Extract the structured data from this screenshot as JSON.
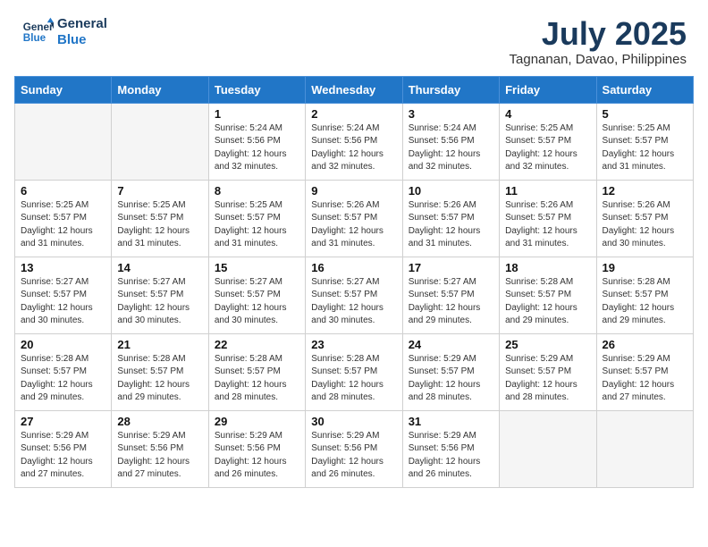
{
  "header": {
    "logo_line1": "General",
    "logo_line2": "Blue",
    "month_year": "July 2025",
    "location": "Tagnanan, Davao, Philippines"
  },
  "weekdays": [
    "Sunday",
    "Monday",
    "Tuesday",
    "Wednesday",
    "Thursday",
    "Friday",
    "Saturday"
  ],
  "weeks": [
    [
      {
        "day": "",
        "detail": ""
      },
      {
        "day": "",
        "detail": ""
      },
      {
        "day": "1",
        "detail": "Sunrise: 5:24 AM\nSunset: 5:56 PM\nDaylight: 12 hours\nand 32 minutes."
      },
      {
        "day": "2",
        "detail": "Sunrise: 5:24 AM\nSunset: 5:56 PM\nDaylight: 12 hours\nand 32 minutes."
      },
      {
        "day": "3",
        "detail": "Sunrise: 5:24 AM\nSunset: 5:56 PM\nDaylight: 12 hours\nand 32 minutes."
      },
      {
        "day": "4",
        "detail": "Sunrise: 5:25 AM\nSunset: 5:57 PM\nDaylight: 12 hours\nand 32 minutes."
      },
      {
        "day": "5",
        "detail": "Sunrise: 5:25 AM\nSunset: 5:57 PM\nDaylight: 12 hours\nand 31 minutes."
      }
    ],
    [
      {
        "day": "6",
        "detail": "Sunrise: 5:25 AM\nSunset: 5:57 PM\nDaylight: 12 hours\nand 31 minutes."
      },
      {
        "day": "7",
        "detail": "Sunrise: 5:25 AM\nSunset: 5:57 PM\nDaylight: 12 hours\nand 31 minutes."
      },
      {
        "day": "8",
        "detail": "Sunrise: 5:25 AM\nSunset: 5:57 PM\nDaylight: 12 hours\nand 31 minutes."
      },
      {
        "day": "9",
        "detail": "Sunrise: 5:26 AM\nSunset: 5:57 PM\nDaylight: 12 hours\nand 31 minutes."
      },
      {
        "day": "10",
        "detail": "Sunrise: 5:26 AM\nSunset: 5:57 PM\nDaylight: 12 hours\nand 31 minutes."
      },
      {
        "day": "11",
        "detail": "Sunrise: 5:26 AM\nSunset: 5:57 PM\nDaylight: 12 hours\nand 31 minutes."
      },
      {
        "day": "12",
        "detail": "Sunrise: 5:26 AM\nSunset: 5:57 PM\nDaylight: 12 hours\nand 30 minutes."
      }
    ],
    [
      {
        "day": "13",
        "detail": "Sunrise: 5:27 AM\nSunset: 5:57 PM\nDaylight: 12 hours\nand 30 minutes."
      },
      {
        "day": "14",
        "detail": "Sunrise: 5:27 AM\nSunset: 5:57 PM\nDaylight: 12 hours\nand 30 minutes."
      },
      {
        "day": "15",
        "detail": "Sunrise: 5:27 AM\nSunset: 5:57 PM\nDaylight: 12 hours\nand 30 minutes."
      },
      {
        "day": "16",
        "detail": "Sunrise: 5:27 AM\nSunset: 5:57 PM\nDaylight: 12 hours\nand 30 minutes."
      },
      {
        "day": "17",
        "detail": "Sunrise: 5:27 AM\nSunset: 5:57 PM\nDaylight: 12 hours\nand 29 minutes."
      },
      {
        "day": "18",
        "detail": "Sunrise: 5:28 AM\nSunset: 5:57 PM\nDaylight: 12 hours\nand 29 minutes."
      },
      {
        "day": "19",
        "detail": "Sunrise: 5:28 AM\nSunset: 5:57 PM\nDaylight: 12 hours\nand 29 minutes."
      }
    ],
    [
      {
        "day": "20",
        "detail": "Sunrise: 5:28 AM\nSunset: 5:57 PM\nDaylight: 12 hours\nand 29 minutes."
      },
      {
        "day": "21",
        "detail": "Sunrise: 5:28 AM\nSunset: 5:57 PM\nDaylight: 12 hours\nand 29 minutes."
      },
      {
        "day": "22",
        "detail": "Sunrise: 5:28 AM\nSunset: 5:57 PM\nDaylight: 12 hours\nand 28 minutes."
      },
      {
        "day": "23",
        "detail": "Sunrise: 5:28 AM\nSunset: 5:57 PM\nDaylight: 12 hours\nand 28 minutes."
      },
      {
        "day": "24",
        "detail": "Sunrise: 5:29 AM\nSunset: 5:57 PM\nDaylight: 12 hours\nand 28 minutes."
      },
      {
        "day": "25",
        "detail": "Sunrise: 5:29 AM\nSunset: 5:57 PM\nDaylight: 12 hours\nand 28 minutes."
      },
      {
        "day": "26",
        "detail": "Sunrise: 5:29 AM\nSunset: 5:57 PM\nDaylight: 12 hours\nand 27 minutes."
      }
    ],
    [
      {
        "day": "27",
        "detail": "Sunrise: 5:29 AM\nSunset: 5:56 PM\nDaylight: 12 hours\nand 27 minutes."
      },
      {
        "day": "28",
        "detail": "Sunrise: 5:29 AM\nSunset: 5:56 PM\nDaylight: 12 hours\nand 27 minutes."
      },
      {
        "day": "29",
        "detail": "Sunrise: 5:29 AM\nSunset: 5:56 PM\nDaylight: 12 hours\nand 26 minutes."
      },
      {
        "day": "30",
        "detail": "Sunrise: 5:29 AM\nSunset: 5:56 PM\nDaylight: 12 hours\nand 26 minutes."
      },
      {
        "day": "31",
        "detail": "Sunrise: 5:29 AM\nSunset: 5:56 PM\nDaylight: 12 hours\nand 26 minutes."
      },
      {
        "day": "",
        "detail": ""
      },
      {
        "day": "",
        "detail": ""
      }
    ]
  ]
}
